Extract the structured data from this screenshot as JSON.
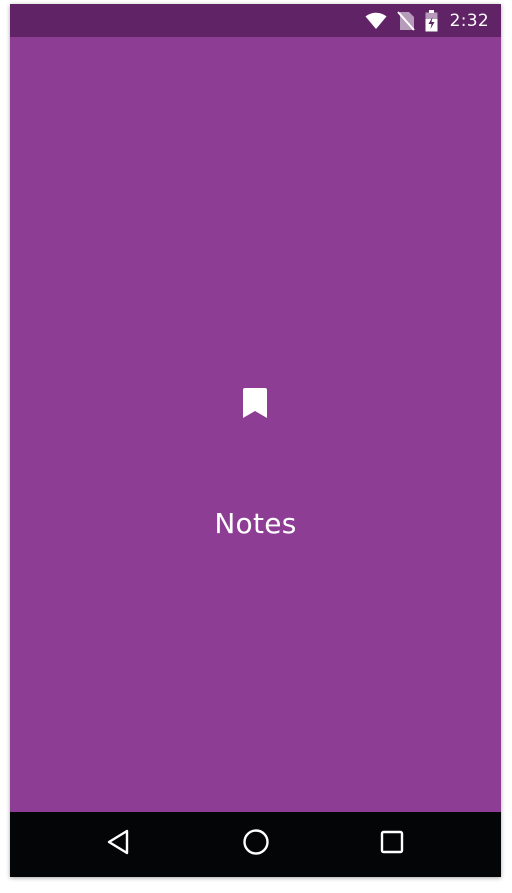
{
  "status_bar": {
    "time": "2:32",
    "icons": [
      "wifi-icon",
      "no-sim-icon",
      "battery-icon"
    ]
  },
  "main": {
    "icon": "bookmark-icon",
    "title": "Notes"
  },
  "nav_bar": {
    "buttons": [
      "back-icon",
      "home-icon",
      "recents-icon"
    ]
  },
  "colors": {
    "background": "#8e3d95",
    "status_bar": "#5f2366",
    "nav_bar": "#030507",
    "foreground": "#ffffff"
  }
}
